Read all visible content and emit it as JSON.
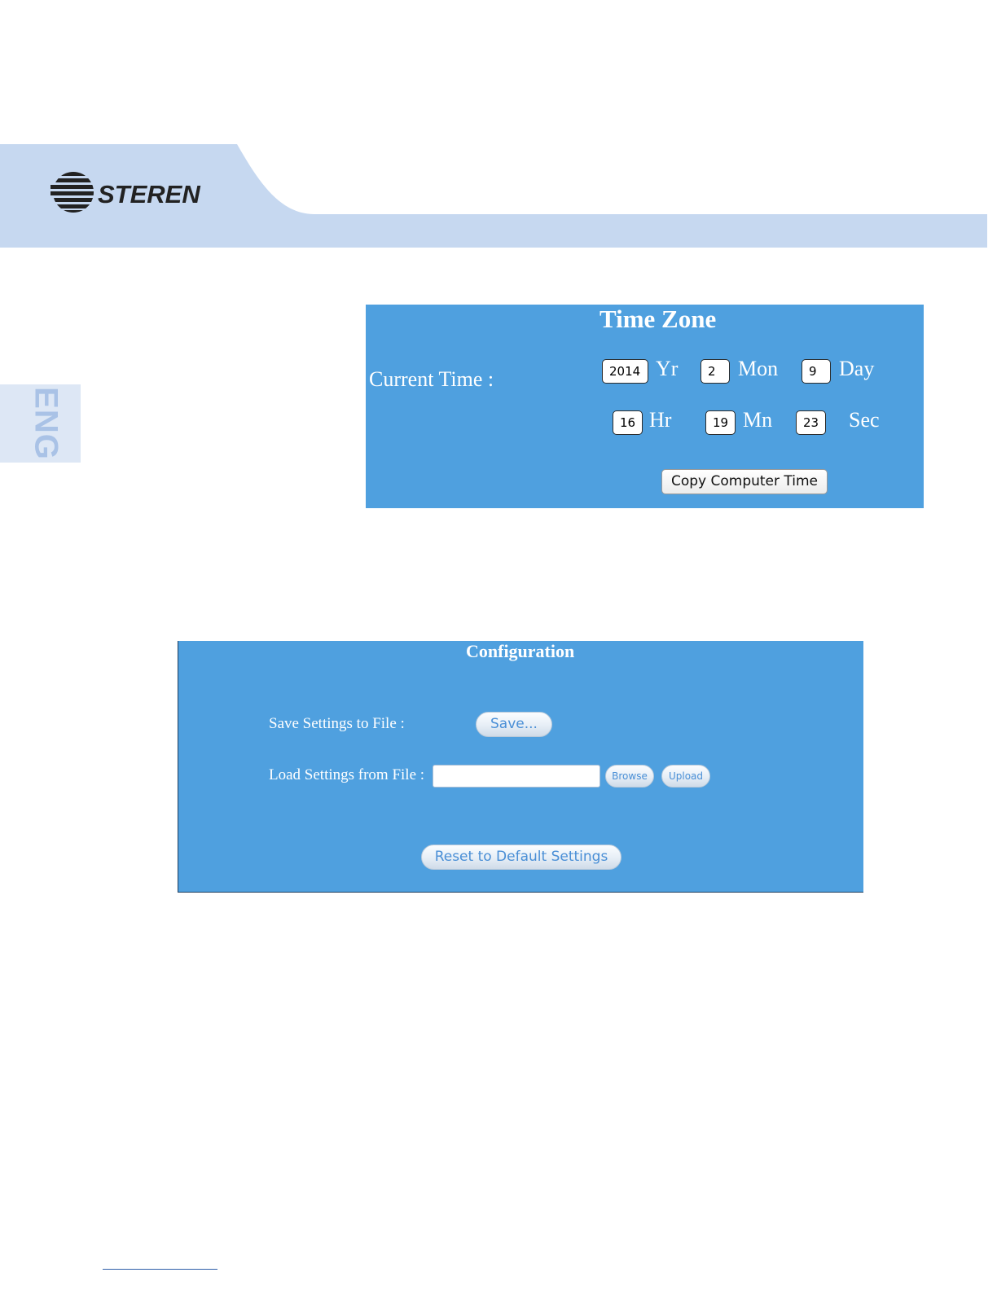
{
  "brand": {
    "logo_text": "STEREN",
    "band_color": "#c6d8f0"
  },
  "language_tab": {
    "label": "ENG",
    "color": "#a9c2e6"
  },
  "time_zone": {
    "title": "Time Zone",
    "current_time_label": "Current Time :",
    "panel_color": "#4fa0df",
    "date": {
      "year": "2014",
      "year_unit": "Yr",
      "month": "2",
      "month_unit": "Mon",
      "day": "9",
      "day_unit": "Day"
    },
    "time": {
      "hour": "16",
      "hour_unit": "Hr",
      "minute": "19",
      "minute_unit": "Mn",
      "second": "23",
      "second_unit": "Sec"
    },
    "copy_button_label": "Copy Computer Time"
  },
  "configuration": {
    "title": "Configuration",
    "save_label": "Save Settings to File :",
    "save_button_label": "Save...",
    "load_label": "Load Settings from File :",
    "file_value": "",
    "browse_button_label": "Browse",
    "upload_button_label": "Upload",
    "reset_button_label": "Reset to Default Settings"
  }
}
